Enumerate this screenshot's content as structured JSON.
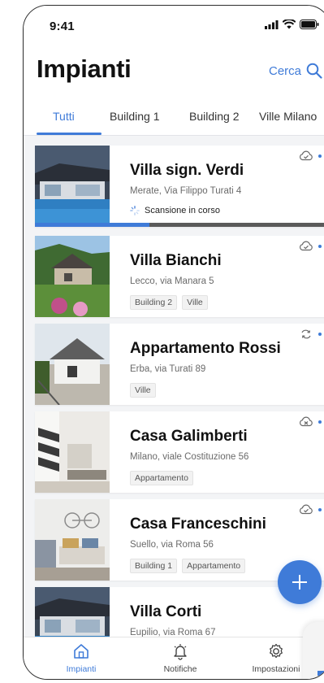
{
  "status_bar": {
    "time": "9:41"
  },
  "header": {
    "title": "Impianti",
    "search_label": "Cerca"
  },
  "tabs": [
    {
      "label": "Tutti",
      "active": true
    },
    {
      "label": "Building 1"
    },
    {
      "label": "Building 2"
    },
    {
      "label": "Ville Milano"
    }
  ],
  "cards": [
    {
      "title": "Villa sign. Verdi",
      "address": "Merate, Via Filippo Turati 4",
      "status": "Scansione in corso",
      "progress": 0.38,
      "tags": []
    },
    {
      "title": "Villa Bianchi",
      "address": "Lecco, via Manara 5",
      "tags": [
        "Building 2",
        "Ville"
      ]
    },
    {
      "title": "Appartamento Rossi",
      "address": "Erba, via Turati 89",
      "tags": [
        "Ville"
      ]
    },
    {
      "title": "Casa Galimberti",
      "address": "Milano,  viale Costituzione 56",
      "tags": [
        "Appartamento"
      ]
    },
    {
      "title": "Casa Franceschini",
      "address": "Suello, via Roma 56",
      "tags": [
        "Building 1",
        "Appartamento"
      ]
    },
    {
      "title": "Villa Corti",
      "address": "Eupilio, via Roma 67",
      "tags": []
    }
  ],
  "bottom_nav": [
    {
      "label": "Impianti",
      "icon": "home-icon",
      "active": true
    },
    {
      "label": "Notifiche",
      "icon": "bell-icon"
    },
    {
      "label": "Impostazioni",
      "icon": "gear-icon"
    }
  ],
  "colors": {
    "accent": "#3f7bd8",
    "progress_track": "#5a5a5a"
  }
}
